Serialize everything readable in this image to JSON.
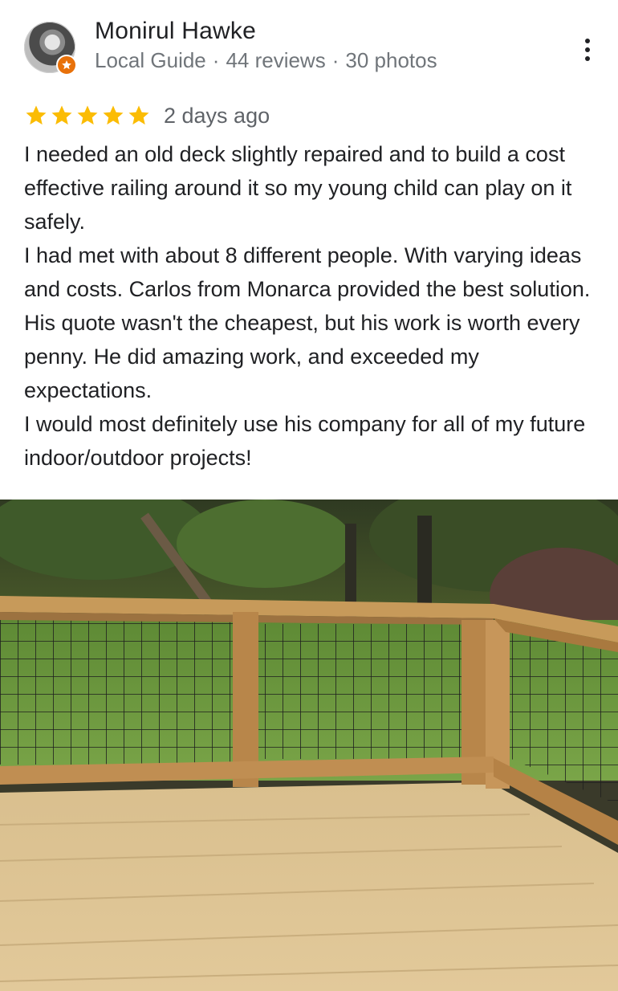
{
  "reviewer": {
    "name": "Monirul Hawke",
    "badge": "Local Guide",
    "reviews": "44 reviews",
    "photos": "30 photos",
    "separator": "·",
    "badge_color": "#e8710a"
  },
  "review": {
    "stars": 5,
    "star_color": "#fbbc04",
    "date": "2 days ago",
    "paragraphs": [
      "I needed an old deck slightly repaired and to build a cost effective railing around it so my young child can play on it safely.",
      "I had met with about 8 different people. With varying ideas and costs. Carlos from Monarca provided the best solution. His quote wasn't the cheapest, but his work is worth every penny. He did amazing work, and exceeded my expectations.",
      "I would most definitely use his company for all of my future indoor/outdoor projects!"
    ]
  },
  "icons": {
    "avatar": "avatar",
    "badge": "local-guide-star-icon",
    "more": "more-vert-icon",
    "star": "star-icon"
  }
}
